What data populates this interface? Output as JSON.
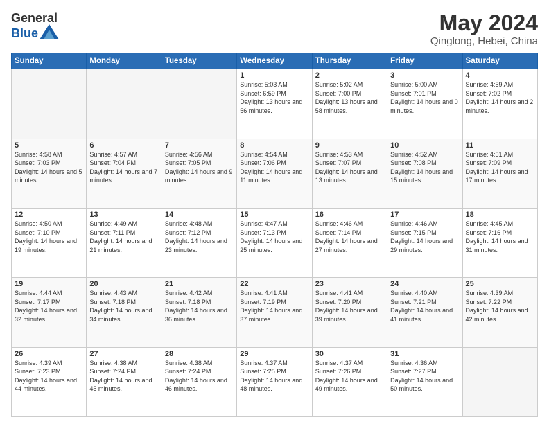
{
  "header": {
    "logo_general": "General",
    "logo_blue": "Blue",
    "title": "May 2024",
    "subtitle": "Qinglong, Hebei, China"
  },
  "days_of_week": [
    "Sunday",
    "Monday",
    "Tuesday",
    "Wednesday",
    "Thursday",
    "Friday",
    "Saturday"
  ],
  "weeks": [
    [
      {
        "day": "",
        "empty": true
      },
      {
        "day": "",
        "empty": true
      },
      {
        "day": "",
        "empty": true
      },
      {
        "day": "1",
        "sunrise": "5:03 AM",
        "sunset": "6:59 PM",
        "daylight": "13 hours and 56 minutes."
      },
      {
        "day": "2",
        "sunrise": "5:02 AM",
        "sunset": "7:00 PM",
        "daylight": "13 hours and 58 minutes."
      },
      {
        "day": "3",
        "sunrise": "5:00 AM",
        "sunset": "7:01 PM",
        "daylight": "14 hours and 0 minutes."
      },
      {
        "day": "4",
        "sunrise": "4:59 AM",
        "sunset": "7:02 PM",
        "daylight": "14 hours and 2 minutes."
      }
    ],
    [
      {
        "day": "5",
        "sunrise": "4:58 AM",
        "sunset": "7:03 PM",
        "daylight": "14 hours and 5 minutes."
      },
      {
        "day": "6",
        "sunrise": "4:57 AM",
        "sunset": "7:04 PM",
        "daylight": "14 hours and 7 minutes."
      },
      {
        "day": "7",
        "sunrise": "4:56 AM",
        "sunset": "7:05 PM",
        "daylight": "14 hours and 9 minutes."
      },
      {
        "day": "8",
        "sunrise": "4:54 AM",
        "sunset": "7:06 PM",
        "daylight": "14 hours and 11 minutes."
      },
      {
        "day": "9",
        "sunrise": "4:53 AM",
        "sunset": "7:07 PM",
        "daylight": "14 hours and 13 minutes."
      },
      {
        "day": "10",
        "sunrise": "4:52 AM",
        "sunset": "7:08 PM",
        "daylight": "14 hours and 15 minutes."
      },
      {
        "day": "11",
        "sunrise": "4:51 AM",
        "sunset": "7:09 PM",
        "daylight": "14 hours and 17 minutes."
      }
    ],
    [
      {
        "day": "12",
        "sunrise": "4:50 AM",
        "sunset": "7:10 PM",
        "daylight": "14 hours and 19 minutes."
      },
      {
        "day": "13",
        "sunrise": "4:49 AM",
        "sunset": "7:11 PM",
        "daylight": "14 hours and 21 minutes."
      },
      {
        "day": "14",
        "sunrise": "4:48 AM",
        "sunset": "7:12 PM",
        "daylight": "14 hours and 23 minutes."
      },
      {
        "day": "15",
        "sunrise": "4:47 AM",
        "sunset": "7:13 PM",
        "daylight": "14 hours and 25 minutes."
      },
      {
        "day": "16",
        "sunrise": "4:46 AM",
        "sunset": "7:14 PM",
        "daylight": "14 hours and 27 minutes."
      },
      {
        "day": "17",
        "sunrise": "4:46 AM",
        "sunset": "7:15 PM",
        "daylight": "14 hours and 29 minutes."
      },
      {
        "day": "18",
        "sunrise": "4:45 AM",
        "sunset": "7:16 PM",
        "daylight": "14 hours and 31 minutes."
      }
    ],
    [
      {
        "day": "19",
        "sunrise": "4:44 AM",
        "sunset": "7:17 PM",
        "daylight": "14 hours and 32 minutes."
      },
      {
        "day": "20",
        "sunrise": "4:43 AM",
        "sunset": "7:18 PM",
        "daylight": "14 hours and 34 minutes."
      },
      {
        "day": "21",
        "sunrise": "4:42 AM",
        "sunset": "7:18 PM",
        "daylight": "14 hours and 36 minutes."
      },
      {
        "day": "22",
        "sunrise": "4:41 AM",
        "sunset": "7:19 PM",
        "daylight": "14 hours and 37 minutes."
      },
      {
        "day": "23",
        "sunrise": "4:41 AM",
        "sunset": "7:20 PM",
        "daylight": "14 hours and 39 minutes."
      },
      {
        "day": "24",
        "sunrise": "4:40 AM",
        "sunset": "7:21 PM",
        "daylight": "14 hours and 41 minutes."
      },
      {
        "day": "25",
        "sunrise": "4:39 AM",
        "sunset": "7:22 PM",
        "daylight": "14 hours and 42 minutes."
      }
    ],
    [
      {
        "day": "26",
        "sunrise": "4:39 AM",
        "sunset": "7:23 PM",
        "daylight": "14 hours and 44 minutes."
      },
      {
        "day": "27",
        "sunrise": "4:38 AM",
        "sunset": "7:24 PM",
        "daylight": "14 hours and 45 minutes."
      },
      {
        "day": "28",
        "sunrise": "4:38 AM",
        "sunset": "7:24 PM",
        "daylight": "14 hours and 46 minutes."
      },
      {
        "day": "29",
        "sunrise": "4:37 AM",
        "sunset": "7:25 PM",
        "daylight": "14 hours and 48 minutes."
      },
      {
        "day": "30",
        "sunrise": "4:37 AM",
        "sunset": "7:26 PM",
        "daylight": "14 hours and 49 minutes."
      },
      {
        "day": "31",
        "sunrise": "4:36 AM",
        "sunset": "7:27 PM",
        "daylight": "14 hours and 50 minutes."
      },
      {
        "day": "",
        "empty": true
      }
    ]
  ]
}
